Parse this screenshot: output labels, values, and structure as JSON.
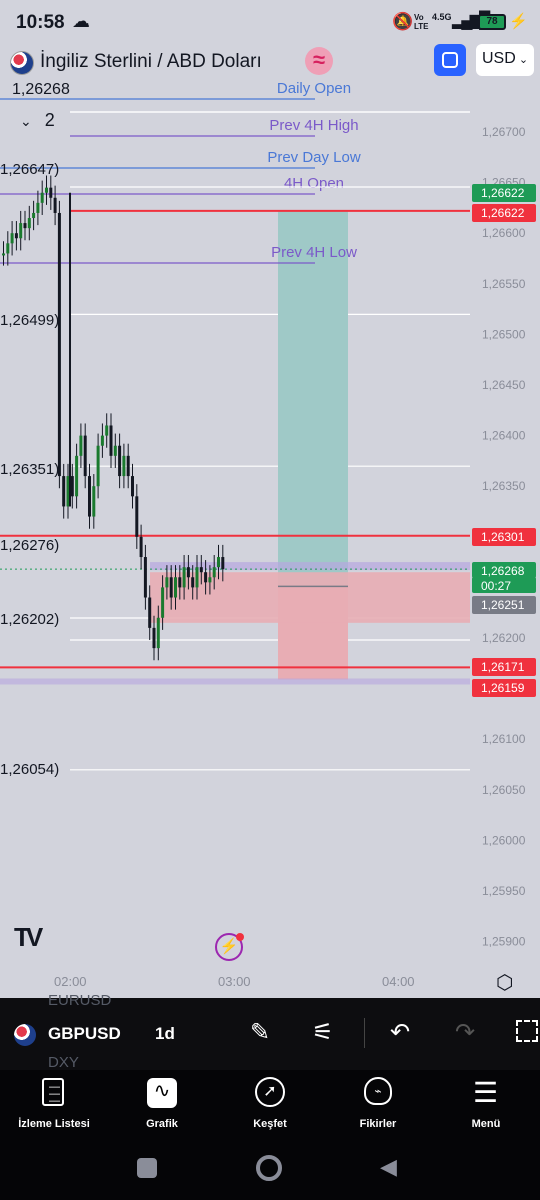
{
  "status_bar": {
    "time": "10:58",
    "network": "4.5G",
    "volte": "Vo LTE",
    "battery": "78"
  },
  "header": {
    "title": "İngiliz Sterlini / ABD Doları",
    "current_price": "1,26268",
    "indicator_count": "2",
    "currency": "USD"
  },
  "chart_data": {
    "type": "candlestick",
    "symbol": "GBPUSD",
    "timeframe": "1d",
    "y_axis_ticks": [
      "1,26700",
      "1,26650",
      "1,26600",
      "1,26550",
      "1,26500",
      "1,26450",
      "1,26400",
      "1,26350",
      "1,26300",
      "1,26250",
      "1,26200",
      "1,26150",
      "1,26100",
      "1,26050",
      "1,26000",
      "1,25950",
      "1,25900"
    ],
    "x_axis_ticks": [
      "02:00",
      "03:00",
      "04:00"
    ],
    "ylim": [
      1.2589,
      1.2672
    ],
    "levels": [
      {
        "name": "Daily Open",
        "price": 1.26738,
        "color": "#4a78d6"
      },
      {
        "name": "Prev 4H High",
        "price": 1.26688,
        "color": "#7b5ac9"
      },
      {
        "name": "Prev Day Low",
        "price": 1.26662,
        "color": "#4a78d6"
      },
      {
        "name": "4H Open",
        "price": 1.2664,
        "color": "#7b5ac9"
      },
      {
        "name": "Prev 4H Low",
        "price": 1.26573,
        "color": "#7b5ac9"
      }
    ],
    "left_labels": [
      "1,26268",
      "1,26647)",
      "1,26499)",
      "1,26351)",
      "1,26276)",
      "1,26202)",
      "1,26054)"
    ],
    "price_labels": [
      {
        "value": "1,26622",
        "color": "#1e9b56"
      },
      {
        "value": "1,26622",
        "color": "#f0313e"
      },
      {
        "value": "1,26301",
        "color": "#f0313e"
      },
      {
        "value": "1,26268",
        "color": "#1e9b56"
      },
      {
        "value": "00:27",
        "color": "#1e9b56"
      },
      {
        "value": "1,26251",
        "color": "#787b86"
      },
      {
        "value": "1,26171",
        "color": "#f0313e"
      },
      {
        "value": "1,26159",
        "color": "#f0313e"
      }
    ],
    "horizontal_lines": [
      {
        "price": 1.26622,
        "color": "#f0313e"
      },
      {
        "price": 1.26301,
        "color": "#f0313e"
      },
      {
        "price": 1.26171,
        "color": "#f0313e"
      }
    ],
    "position": {
      "entry": 1.26251,
      "target": 1.26622,
      "stop": 1.26159
    },
    "candles_close_series": [
      1.2658,
      1.2659,
      1.266,
      1.26595,
      1.2661,
      1.26605,
      1.26615,
      1.2662,
      1.2663,
      1.2664,
      1.26645,
      1.26635,
      1.2662,
      1.2636,
      1.2633,
      1.2636,
      1.2634,
      1.2638,
      1.264,
      1.2636,
      1.2632,
      1.2635,
      1.2639,
      1.264,
      1.2641,
      1.2638,
      1.2639,
      1.2636,
      1.2638,
      1.2636,
      1.2634,
      1.263,
      1.2628,
      1.2624,
      1.2621,
      1.2619,
      1.2622,
      1.2625,
      1.2626,
      1.2624,
      1.2626,
      1.2625,
      1.2627,
      1.2626,
      1.2625,
      1.2627,
      1.26265,
      1.26255,
      1.2626,
      1.2627,
      1.2628,
      1.26268
    ]
  },
  "toolbar": {
    "symbol": "GBPUSD",
    "interval": "1d",
    "list_above": "EURUSD",
    "list_below": "DXY"
  },
  "nav": [
    {
      "label": "İzleme Listesi",
      "icon": "watchlist-icon"
    },
    {
      "label": "Grafik",
      "icon": "chart-icon"
    },
    {
      "label": "Keşfet",
      "icon": "compass-icon"
    },
    {
      "label": "Fikirler",
      "icon": "lightbulb-icon"
    },
    {
      "label": "Menü",
      "icon": "menu-icon"
    }
  ],
  "colors": {
    "up": "#26a69a",
    "candle": "#1a7a2e",
    "down": "#131722",
    "target_zone": "#9fc9c7",
    "stop_zone": "#e8adb4"
  }
}
